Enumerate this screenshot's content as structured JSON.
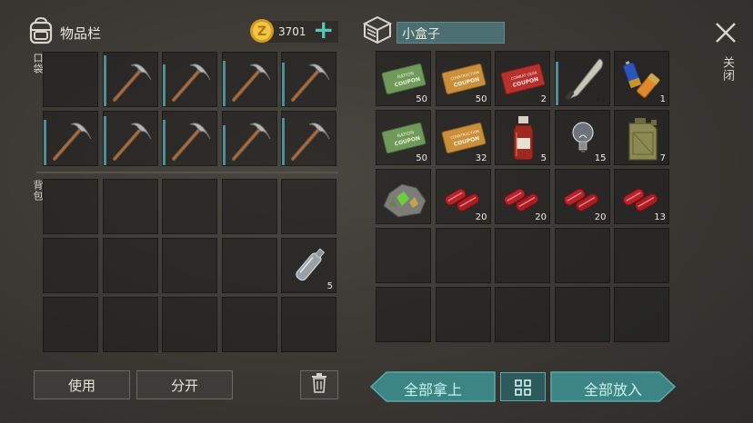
{
  "inventory": {
    "title": "物品栏",
    "icon": "backpack-icon",
    "currency_icon": "coin-icon",
    "currency_value": "3701",
    "add_label": "+",
    "pocket_label": "口袋",
    "backpack_label": "背包"
  },
  "pocket": [
    {
      "item": "empty"
    },
    {
      "item": "pickaxe-icon"
    },
    {
      "item": "pickaxe-icon"
    },
    {
      "item": "pickaxe-icon"
    },
    {
      "item": "pickaxe-icon"
    },
    {
      "item": "pickaxe-icon"
    },
    {
      "item": "pickaxe-icon"
    },
    {
      "item": "pickaxe-icon"
    },
    {
      "item": "pickaxe-icon"
    },
    {
      "item": "pickaxe-icon"
    }
  ],
  "backpack": [
    {
      "item": "empty"
    },
    {
      "item": "empty"
    },
    {
      "item": "empty"
    },
    {
      "item": "empty"
    },
    {
      "item": "empty"
    },
    {
      "item": "empty"
    },
    {
      "item": "empty"
    },
    {
      "item": "empty"
    },
    {
      "item": "empty"
    },
    {
      "item": "bottle-icon",
      "count": "5"
    },
    {
      "item": "empty"
    },
    {
      "item": "empty"
    },
    {
      "item": "empty"
    },
    {
      "item": "empty"
    },
    {
      "item": "empty"
    }
  ],
  "container": {
    "icon": "box-icon",
    "title": "小盒子",
    "close_label": "关闭",
    "close_icon": "close-icon"
  },
  "container_items": [
    {
      "item": "ration-coupon-icon",
      "count": "50",
      "text": "RATION COUPON"
    },
    {
      "item": "construction-coupon-icon",
      "count": "50",
      "text": "CONSTRUCTION COUPON"
    },
    {
      "item": "combat-gear-coupon-icon",
      "count": "2",
      "text": "COMBAT GEAR COUPON"
    },
    {
      "item": "machete-icon",
      "count": ""
    },
    {
      "item": "batteries-icon",
      "count": "1"
    },
    {
      "item": "ration-coupon-icon",
      "count": "50",
      "text": "RATION COUPON"
    },
    {
      "item": "construction-coupon-icon",
      "count": "32",
      "text": "CONSTRUCTION COUPON"
    },
    {
      "item": "medicine-bottle-icon",
      "count": "5"
    },
    {
      "item": "light-bulb-icon",
      "count": "15"
    },
    {
      "item": "jerrycan-icon",
      "count": "7"
    },
    {
      "item": "ore-icon",
      "count": ""
    },
    {
      "item": "raw-meat-icon",
      "count": "20"
    },
    {
      "item": "raw-meat-icon",
      "count": "20"
    },
    {
      "item": "raw-meat-icon",
      "count": "20"
    },
    {
      "item": "raw-meat-icon",
      "count": "13"
    }
  ],
  "buttons": {
    "use": "使用",
    "split": "分开",
    "trash_icon": "trash-icon",
    "take_all": "全部拿上",
    "sort_icon": "grid-icon",
    "put_all": "全部放入"
  }
}
